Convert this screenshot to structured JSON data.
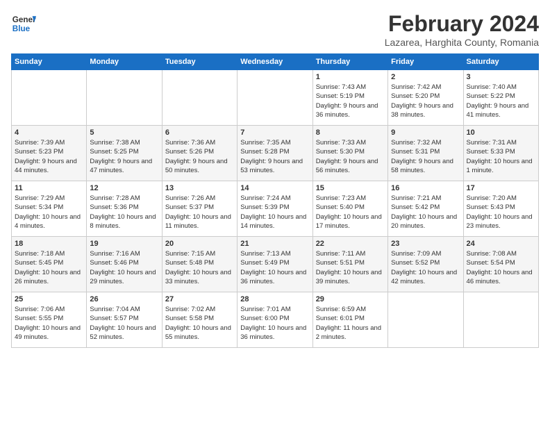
{
  "header": {
    "logo_line1": "General",
    "logo_line2": "Blue",
    "month_title": "February 2024",
    "location": "Lazarea, Harghita County, Romania"
  },
  "weekdays": [
    "Sunday",
    "Monday",
    "Tuesday",
    "Wednesday",
    "Thursday",
    "Friday",
    "Saturday"
  ],
  "weeks": [
    [
      {
        "day": "",
        "sunrise": "",
        "sunset": "",
        "daylight": ""
      },
      {
        "day": "",
        "sunrise": "",
        "sunset": "",
        "daylight": ""
      },
      {
        "day": "",
        "sunrise": "",
        "sunset": "",
        "daylight": ""
      },
      {
        "day": "",
        "sunrise": "",
        "sunset": "",
        "daylight": ""
      },
      {
        "day": "1",
        "sunrise": "Sunrise: 7:43 AM",
        "sunset": "Sunset: 5:19 PM",
        "daylight": "Daylight: 9 hours and 36 minutes."
      },
      {
        "day": "2",
        "sunrise": "Sunrise: 7:42 AM",
        "sunset": "Sunset: 5:20 PM",
        "daylight": "Daylight: 9 hours and 38 minutes."
      },
      {
        "day": "3",
        "sunrise": "Sunrise: 7:40 AM",
        "sunset": "Sunset: 5:22 PM",
        "daylight": "Daylight: 9 hours and 41 minutes."
      }
    ],
    [
      {
        "day": "4",
        "sunrise": "Sunrise: 7:39 AM",
        "sunset": "Sunset: 5:23 PM",
        "daylight": "Daylight: 9 hours and 44 minutes."
      },
      {
        "day": "5",
        "sunrise": "Sunrise: 7:38 AM",
        "sunset": "Sunset: 5:25 PM",
        "daylight": "Daylight: 9 hours and 47 minutes."
      },
      {
        "day": "6",
        "sunrise": "Sunrise: 7:36 AM",
        "sunset": "Sunset: 5:26 PM",
        "daylight": "Daylight: 9 hours and 50 minutes."
      },
      {
        "day": "7",
        "sunrise": "Sunrise: 7:35 AM",
        "sunset": "Sunset: 5:28 PM",
        "daylight": "Daylight: 9 hours and 53 minutes."
      },
      {
        "day": "8",
        "sunrise": "Sunrise: 7:33 AM",
        "sunset": "Sunset: 5:30 PM",
        "daylight": "Daylight: 9 hours and 56 minutes."
      },
      {
        "day": "9",
        "sunrise": "Sunrise: 7:32 AM",
        "sunset": "Sunset: 5:31 PM",
        "daylight": "Daylight: 9 hours and 58 minutes."
      },
      {
        "day": "10",
        "sunrise": "Sunrise: 7:31 AM",
        "sunset": "Sunset: 5:33 PM",
        "daylight": "Daylight: 10 hours and 1 minute."
      }
    ],
    [
      {
        "day": "11",
        "sunrise": "Sunrise: 7:29 AM",
        "sunset": "Sunset: 5:34 PM",
        "daylight": "Daylight: 10 hours and 4 minutes."
      },
      {
        "day": "12",
        "sunrise": "Sunrise: 7:28 AM",
        "sunset": "Sunset: 5:36 PM",
        "daylight": "Daylight: 10 hours and 8 minutes."
      },
      {
        "day": "13",
        "sunrise": "Sunrise: 7:26 AM",
        "sunset": "Sunset: 5:37 PM",
        "daylight": "Daylight: 10 hours and 11 minutes."
      },
      {
        "day": "14",
        "sunrise": "Sunrise: 7:24 AM",
        "sunset": "Sunset: 5:39 PM",
        "daylight": "Daylight: 10 hours and 14 minutes."
      },
      {
        "day": "15",
        "sunrise": "Sunrise: 7:23 AM",
        "sunset": "Sunset: 5:40 PM",
        "daylight": "Daylight: 10 hours and 17 minutes."
      },
      {
        "day": "16",
        "sunrise": "Sunrise: 7:21 AM",
        "sunset": "Sunset: 5:42 PM",
        "daylight": "Daylight: 10 hours and 20 minutes."
      },
      {
        "day": "17",
        "sunrise": "Sunrise: 7:20 AM",
        "sunset": "Sunset: 5:43 PM",
        "daylight": "Daylight: 10 hours and 23 minutes."
      }
    ],
    [
      {
        "day": "18",
        "sunrise": "Sunrise: 7:18 AM",
        "sunset": "Sunset: 5:45 PM",
        "daylight": "Daylight: 10 hours and 26 minutes."
      },
      {
        "day": "19",
        "sunrise": "Sunrise: 7:16 AM",
        "sunset": "Sunset: 5:46 PM",
        "daylight": "Daylight: 10 hours and 29 minutes."
      },
      {
        "day": "20",
        "sunrise": "Sunrise: 7:15 AM",
        "sunset": "Sunset: 5:48 PM",
        "daylight": "Daylight: 10 hours and 33 minutes."
      },
      {
        "day": "21",
        "sunrise": "Sunrise: 7:13 AM",
        "sunset": "Sunset: 5:49 PM",
        "daylight": "Daylight: 10 hours and 36 minutes."
      },
      {
        "day": "22",
        "sunrise": "Sunrise: 7:11 AM",
        "sunset": "Sunset: 5:51 PM",
        "daylight": "Daylight: 10 hours and 39 minutes."
      },
      {
        "day": "23",
        "sunrise": "Sunrise: 7:09 AM",
        "sunset": "Sunset: 5:52 PM",
        "daylight": "Daylight: 10 hours and 42 minutes."
      },
      {
        "day": "24",
        "sunrise": "Sunrise: 7:08 AM",
        "sunset": "Sunset: 5:54 PM",
        "daylight": "Daylight: 10 hours and 46 minutes."
      }
    ],
    [
      {
        "day": "25",
        "sunrise": "Sunrise: 7:06 AM",
        "sunset": "Sunset: 5:55 PM",
        "daylight": "Daylight: 10 hours and 49 minutes."
      },
      {
        "day": "26",
        "sunrise": "Sunrise: 7:04 AM",
        "sunset": "Sunset: 5:57 PM",
        "daylight": "Daylight: 10 hours and 52 minutes."
      },
      {
        "day": "27",
        "sunrise": "Sunrise: 7:02 AM",
        "sunset": "Sunset: 5:58 PM",
        "daylight": "Daylight: 10 hours and 55 minutes."
      },
      {
        "day": "28",
        "sunrise": "Sunrise: 7:01 AM",
        "sunset": "Sunset: 6:00 PM",
        "daylight": "Daylight: 10 hours and 36 minutes."
      },
      {
        "day": "29",
        "sunrise": "Sunrise: 6:59 AM",
        "sunset": "Sunset: 6:01 PM",
        "daylight": "Daylight: 11 hours and 2 minutes."
      },
      {
        "day": "",
        "sunrise": "",
        "sunset": "",
        "daylight": ""
      },
      {
        "day": "",
        "sunrise": "",
        "sunset": "",
        "daylight": ""
      }
    ]
  ]
}
